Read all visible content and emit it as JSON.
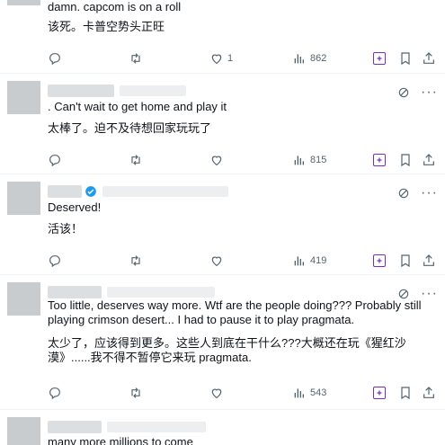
{
  "posts": [
    {
      "text_en": "damn. capcom is on a roll",
      "text_zh": "该死。卡普空势头正旺",
      "likes": "1",
      "views": "862"
    },
    {
      "text_en": ". Can't wait to get home and play it",
      "text_zh": "太棒了。迫不及待想回家玩玩了",
      "views": "815"
    },
    {
      "text_en": "Deserved!",
      "text_zh": "活该！",
      "views": "419"
    },
    {
      "text_en": "Too little, deserves way more. Wtf are the people doing??? Probably still playing crimson desert... I had to pause it to play pragmata.",
      "text_zh": "太少了，应该得到更多。这些人到底在干什么???大概还在玩《猩红沙漠》......我不得不暂停它来玩 pragmata.",
      "views": "543"
    },
    {
      "text_en": "many more millions to come"
    }
  ],
  "icons": {
    "reply": "reply-icon",
    "retweet": "retweet-icon",
    "like": "like-icon",
    "views": "views-icon",
    "grok": "grok-icon",
    "bookmark": "bookmark-icon",
    "share": "share-icon",
    "more": "more-icon",
    "translate": "translate-icon",
    "verified": "verified-badge-icon"
  },
  "colors": {
    "text": "#0f1419",
    "muted": "#536471",
    "grok": "#7b2cbf",
    "verified": "#1d9bf0"
  }
}
